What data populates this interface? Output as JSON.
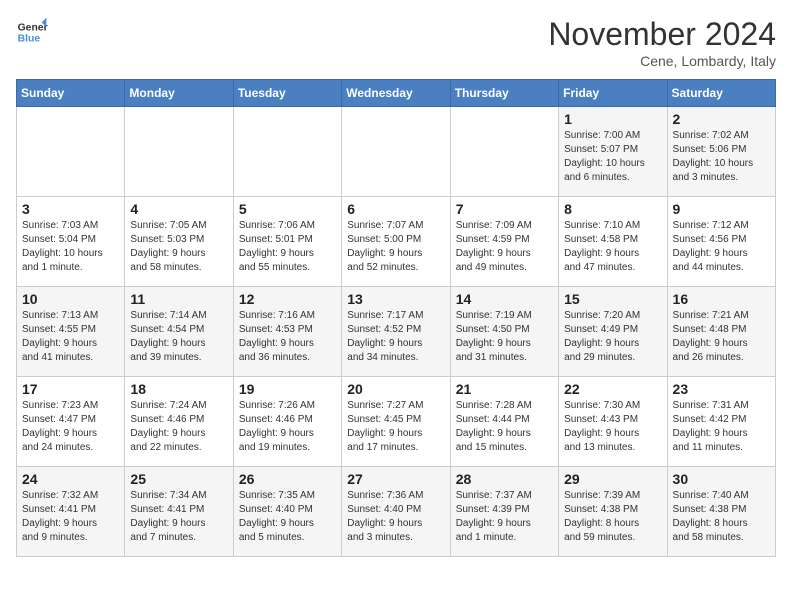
{
  "logo": {
    "line1": "General",
    "line2": "Blue"
  },
  "title": "November 2024",
  "location": "Cene, Lombardy, Italy",
  "headers": [
    "Sunday",
    "Monday",
    "Tuesday",
    "Wednesday",
    "Thursday",
    "Friday",
    "Saturday"
  ],
  "weeks": [
    [
      {
        "day": "",
        "info": ""
      },
      {
        "day": "",
        "info": ""
      },
      {
        "day": "",
        "info": ""
      },
      {
        "day": "",
        "info": ""
      },
      {
        "day": "",
        "info": ""
      },
      {
        "day": "1",
        "info": "Sunrise: 7:00 AM\nSunset: 5:07 PM\nDaylight: 10 hours\nand 6 minutes."
      },
      {
        "day": "2",
        "info": "Sunrise: 7:02 AM\nSunset: 5:06 PM\nDaylight: 10 hours\nand 3 minutes."
      }
    ],
    [
      {
        "day": "3",
        "info": "Sunrise: 7:03 AM\nSunset: 5:04 PM\nDaylight: 10 hours\nand 1 minute."
      },
      {
        "day": "4",
        "info": "Sunrise: 7:05 AM\nSunset: 5:03 PM\nDaylight: 9 hours\nand 58 minutes."
      },
      {
        "day": "5",
        "info": "Sunrise: 7:06 AM\nSunset: 5:01 PM\nDaylight: 9 hours\nand 55 minutes."
      },
      {
        "day": "6",
        "info": "Sunrise: 7:07 AM\nSunset: 5:00 PM\nDaylight: 9 hours\nand 52 minutes."
      },
      {
        "day": "7",
        "info": "Sunrise: 7:09 AM\nSunset: 4:59 PM\nDaylight: 9 hours\nand 49 minutes."
      },
      {
        "day": "8",
        "info": "Sunrise: 7:10 AM\nSunset: 4:58 PM\nDaylight: 9 hours\nand 47 minutes."
      },
      {
        "day": "9",
        "info": "Sunrise: 7:12 AM\nSunset: 4:56 PM\nDaylight: 9 hours\nand 44 minutes."
      }
    ],
    [
      {
        "day": "10",
        "info": "Sunrise: 7:13 AM\nSunset: 4:55 PM\nDaylight: 9 hours\nand 41 minutes."
      },
      {
        "day": "11",
        "info": "Sunrise: 7:14 AM\nSunset: 4:54 PM\nDaylight: 9 hours\nand 39 minutes."
      },
      {
        "day": "12",
        "info": "Sunrise: 7:16 AM\nSunset: 4:53 PM\nDaylight: 9 hours\nand 36 minutes."
      },
      {
        "day": "13",
        "info": "Sunrise: 7:17 AM\nSunset: 4:52 PM\nDaylight: 9 hours\nand 34 minutes."
      },
      {
        "day": "14",
        "info": "Sunrise: 7:19 AM\nSunset: 4:50 PM\nDaylight: 9 hours\nand 31 minutes."
      },
      {
        "day": "15",
        "info": "Sunrise: 7:20 AM\nSunset: 4:49 PM\nDaylight: 9 hours\nand 29 minutes."
      },
      {
        "day": "16",
        "info": "Sunrise: 7:21 AM\nSunset: 4:48 PM\nDaylight: 9 hours\nand 26 minutes."
      }
    ],
    [
      {
        "day": "17",
        "info": "Sunrise: 7:23 AM\nSunset: 4:47 PM\nDaylight: 9 hours\nand 24 minutes."
      },
      {
        "day": "18",
        "info": "Sunrise: 7:24 AM\nSunset: 4:46 PM\nDaylight: 9 hours\nand 22 minutes."
      },
      {
        "day": "19",
        "info": "Sunrise: 7:26 AM\nSunset: 4:46 PM\nDaylight: 9 hours\nand 19 minutes."
      },
      {
        "day": "20",
        "info": "Sunrise: 7:27 AM\nSunset: 4:45 PM\nDaylight: 9 hours\nand 17 minutes."
      },
      {
        "day": "21",
        "info": "Sunrise: 7:28 AM\nSunset: 4:44 PM\nDaylight: 9 hours\nand 15 minutes."
      },
      {
        "day": "22",
        "info": "Sunrise: 7:30 AM\nSunset: 4:43 PM\nDaylight: 9 hours\nand 13 minutes."
      },
      {
        "day": "23",
        "info": "Sunrise: 7:31 AM\nSunset: 4:42 PM\nDaylight: 9 hours\nand 11 minutes."
      }
    ],
    [
      {
        "day": "24",
        "info": "Sunrise: 7:32 AM\nSunset: 4:41 PM\nDaylight: 9 hours\nand 9 minutes."
      },
      {
        "day": "25",
        "info": "Sunrise: 7:34 AM\nSunset: 4:41 PM\nDaylight: 9 hours\nand 7 minutes."
      },
      {
        "day": "26",
        "info": "Sunrise: 7:35 AM\nSunset: 4:40 PM\nDaylight: 9 hours\nand 5 minutes."
      },
      {
        "day": "27",
        "info": "Sunrise: 7:36 AM\nSunset: 4:40 PM\nDaylight: 9 hours\nand 3 minutes."
      },
      {
        "day": "28",
        "info": "Sunrise: 7:37 AM\nSunset: 4:39 PM\nDaylight: 9 hours\nand 1 minute."
      },
      {
        "day": "29",
        "info": "Sunrise: 7:39 AM\nSunset: 4:38 PM\nDaylight: 8 hours\nand 59 minutes."
      },
      {
        "day": "30",
        "info": "Sunrise: 7:40 AM\nSunset: 4:38 PM\nDaylight: 8 hours\nand 58 minutes."
      }
    ]
  ]
}
